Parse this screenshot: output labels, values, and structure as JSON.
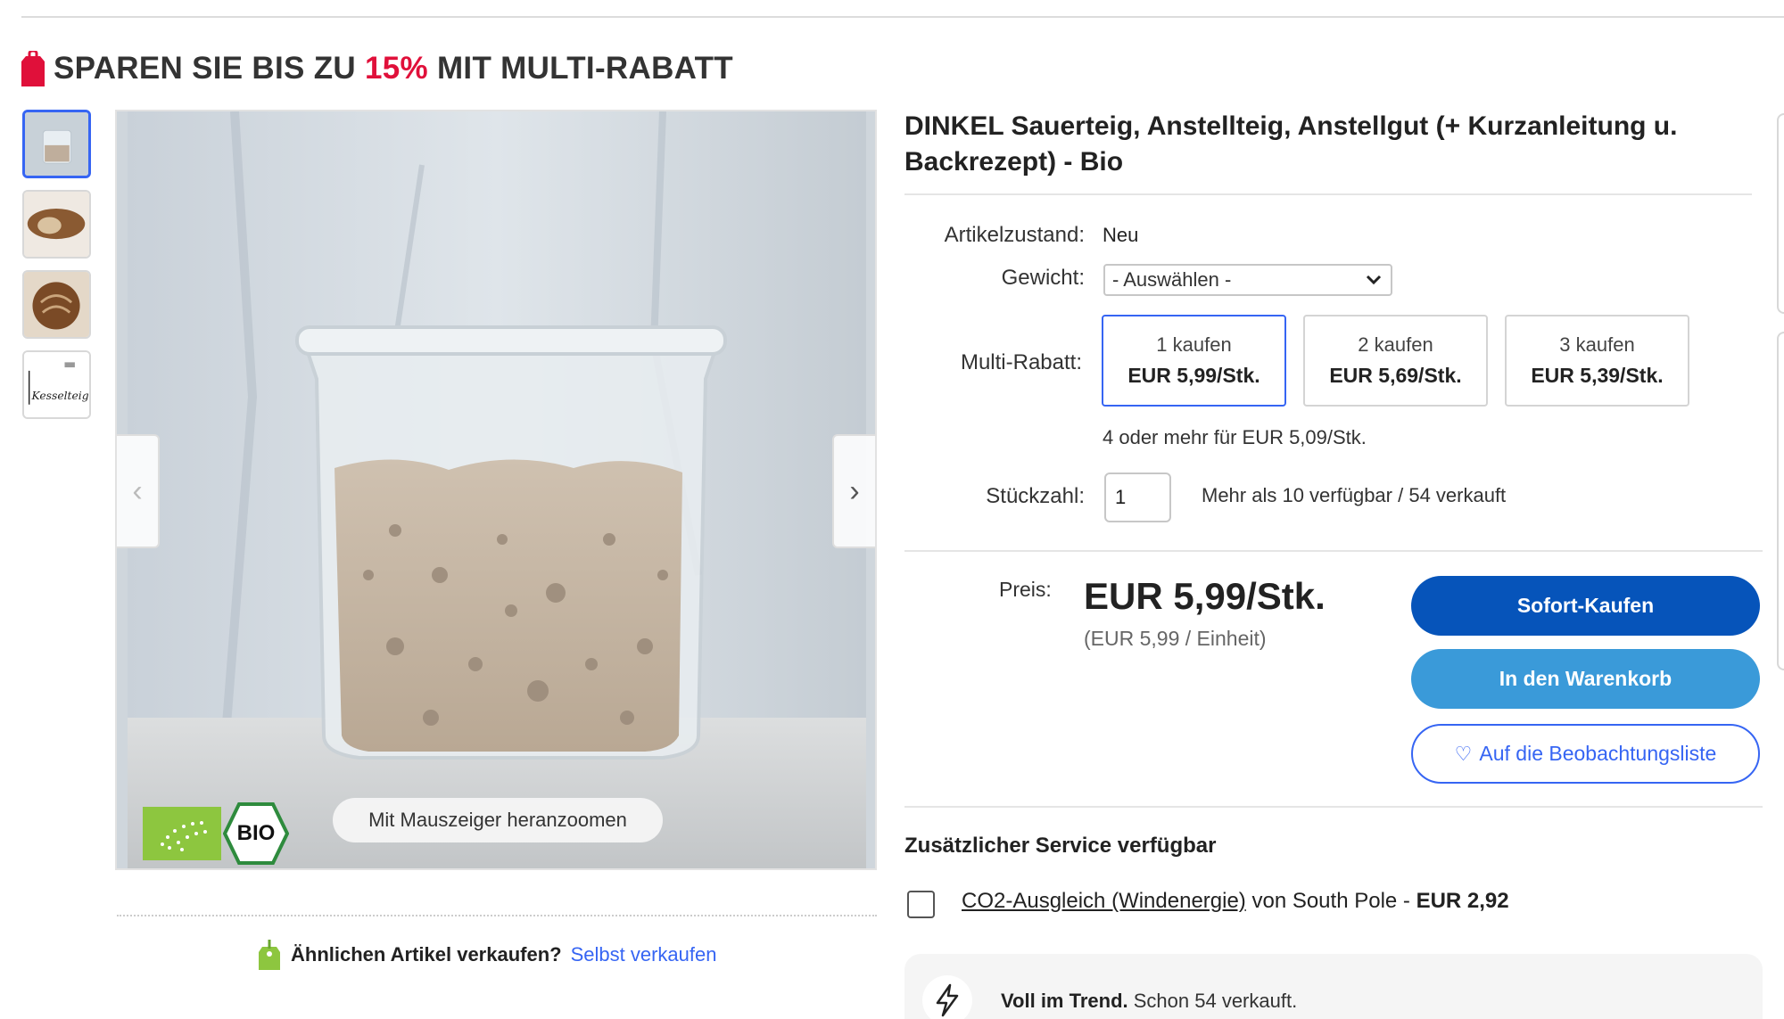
{
  "promo": {
    "prefix": "SPAREN SIE BIS ZU ",
    "percent": "15%",
    "suffix": " MIT MULTI-RABATT",
    "accent_color": "#e0103a"
  },
  "gallery": {
    "thumbnails": [
      {
        "name": "jar-thumbnail",
        "active": true
      },
      {
        "name": "bread-loaf-thumbnail",
        "active": false
      },
      {
        "name": "bread-round-thumbnail",
        "active": false
      },
      {
        "name": "handwritten-label-thumbnail",
        "active": false,
        "caption": "Kesselteig"
      }
    ],
    "prev_icon": "‹",
    "next_icon": "›",
    "zoom_hint": "Mit Mauszeiger heranzoomen",
    "bio_label": "BIO"
  },
  "sell": {
    "question": "Ähnlichen Artikel verkaufen?",
    "link": "Selbst verkaufen"
  },
  "product": {
    "title": "DINKEL Sauerteig, Anstellteig, Anstellgut (+ Kurzanleitung u. Backrezept) - Bio",
    "condition_label": "Artikelzustand:",
    "condition_value": "Neu",
    "weight_label": "Gewicht:",
    "weight_select": "- Auswählen -",
    "multi_label": "Multi-Rabatt:",
    "tiers": [
      {
        "qty": "1 kaufen",
        "price": "EUR 5,99/Stk.",
        "selected": true
      },
      {
        "qty": "2 kaufen",
        "price": "EUR 5,69/Stk.",
        "selected": false
      },
      {
        "qty": "3 kaufen",
        "price": "EUR 5,39/Stk.",
        "selected": false
      }
    ],
    "more_tier": "4 oder mehr für EUR 5,09/Stk.",
    "qty_label": "Stückzahl:",
    "qty_value": "1",
    "availability": "Mehr als 10 verfügbar / 54 verkauft"
  },
  "pricing": {
    "label": "Preis:",
    "price": "EUR 5,99/Stk.",
    "unit_price": "(EUR 5,99 / Einheit)"
  },
  "actions": {
    "buy_now": "Sofort-Kaufen",
    "add_to_cart": "In den Warenkorb",
    "watch": "Auf die Beobachtungsliste",
    "buy_color": "#0654ba",
    "cart_color": "#3a9ad9",
    "link_color": "#3665f3"
  },
  "service": {
    "heading": "Zusätzlicher Service verfügbar",
    "option_link": "CO2-Ausgleich (Windenergie)",
    "option_text": " von South Pole - ",
    "option_amount": "EUR 2,92"
  },
  "trend": {
    "bold": "Voll im Trend.",
    "text": " Schon 54 verkauft."
  }
}
